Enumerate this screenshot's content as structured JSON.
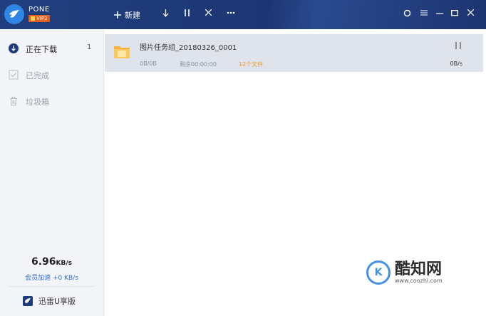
{
  "app": {
    "brand": "PONE",
    "vip_badge": "VIP2"
  },
  "toolbar": {
    "new_label": "新建"
  },
  "sidebar": {
    "items": [
      {
        "label": "正在下载",
        "count": "1",
        "icon": "download-circle-icon"
      },
      {
        "label": "已完成",
        "count": "",
        "icon": "check-square-icon"
      },
      {
        "label": "垃圾箱",
        "count": "",
        "icon": "trash-icon"
      }
    ],
    "speed_value": "6.96",
    "speed_unit": "KB/s",
    "speed_sub": "会员加速 +0 KB/s",
    "bottom_link": "迅雷U享版"
  },
  "tasks": [
    {
      "name": "图片任务组_20180326_0001",
      "size": "0B/0B",
      "remaining": "剩余00:00:00",
      "files": "12个文件",
      "speed": "0B/s"
    }
  ],
  "watermark": {
    "mark": "K",
    "title": "酷知网",
    "url": "www.coozhi.com"
  },
  "colors": {
    "topbar": "#1f3a78",
    "accent": "#2f86e6",
    "orange": "#f39a2b",
    "selected_row": "#dfe3eb"
  }
}
